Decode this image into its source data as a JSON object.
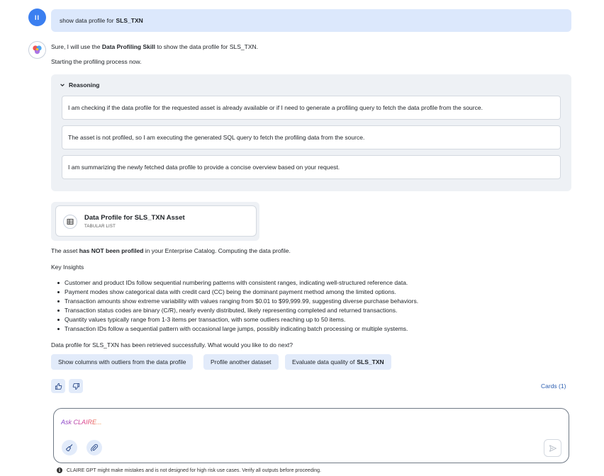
{
  "user_message": {
    "avatar_initials": "II",
    "prefix": "show data profile for",
    "asset": "SLS_TXN"
  },
  "response": {
    "intro_prefix": "Sure, I will use the",
    "intro_skill": "Data Profiling Skill",
    "intro_suffix": "to show the data profile for SLS_TXN.",
    "starting": "Starting the profiling process now."
  },
  "reasoning": {
    "label": "Reasoning",
    "steps": [
      "I am checking if the data profile for the requested asset is already available or if I need to generate a profiling query to fetch the data profile from the source.",
      "The asset is not profiled, so I am executing the generated SQL query to fetch the profiling data from the source.",
      "I am summarizing the newly fetched data profile to provide a concise overview based on your request."
    ]
  },
  "card": {
    "title": "Data Profile for SLS_TXN Asset",
    "subtitle": "TABULAR LIST",
    "icon": "table-icon"
  },
  "status": {
    "prefix": "The asset",
    "bold": "has NOT been profiled",
    "suffix": "in your Enterprise Catalog. Computing the data profile."
  },
  "insights": {
    "heading": "Key Insights",
    "items": [
      "Customer and product IDs follow sequential numbering patterns with consistent ranges, indicating well-structured reference data.",
      "Payment modes show categorical data with credit card (CC) being the dominant payment method among the limited options.",
      "Transaction amounts show extreme variability with values ranging from $0.01 to $99,999.99, suggesting diverse purchase behaviors.",
      "Transaction status codes are binary (C/R), nearly evenly distributed, likely representing completed and returned transactions.",
      "Quantity values typically range from 1-3 items per transaction, with some outliers reaching up to 50 items.",
      "Transaction IDs follow a sequential pattern with occasional large jumps, possibly indicating batch processing or multiple systems."
    ]
  },
  "followup": "Data profile for SLS_TXN has been retrieved successfully. What would you like to do next?",
  "suggestions": {
    "s1": "Show columns with outliers from the data profile",
    "s2": "Profile another dataset",
    "s3_prefix": "Evaluate data quality of",
    "s3_bold": "SLS_TXN"
  },
  "cards_link": "Cards (1)",
  "input": {
    "placeholder": "Ask CLAIRE..."
  },
  "disclaimer": "CLAIRE GPT might make mistakes and is not designed for high risk use cases. Verify all outputs before proceeding.",
  "colors": {
    "user_avatar": "#3b7ff0",
    "user_bubble": "#dce8fc",
    "chip": "#e2ebfa",
    "panel": "#eef1f5",
    "link": "#2a5db0"
  }
}
